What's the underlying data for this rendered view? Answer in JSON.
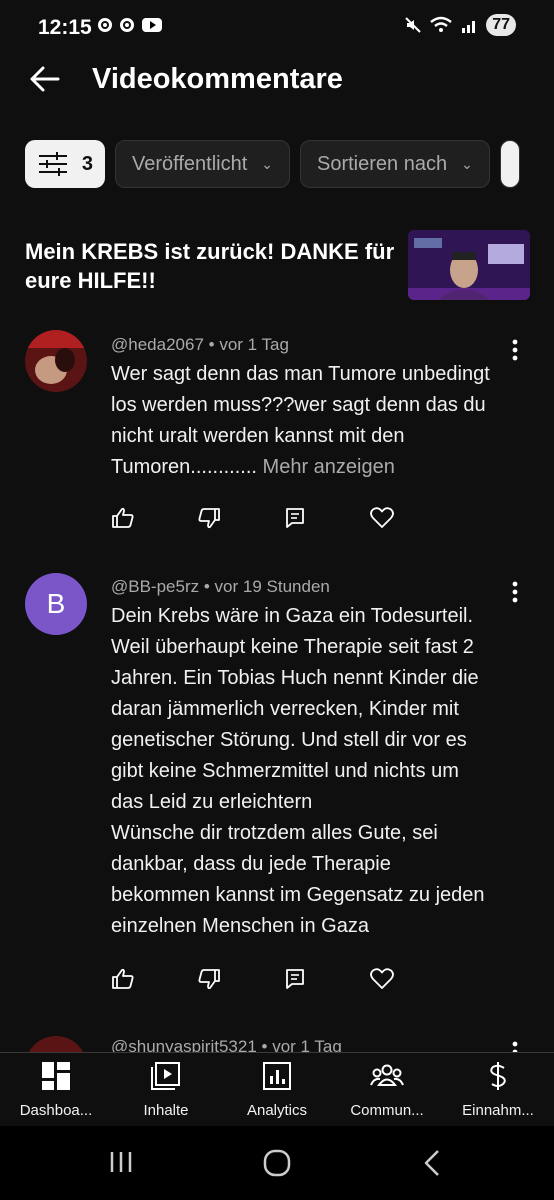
{
  "status_bar": {
    "time": "12:15",
    "battery": "77"
  },
  "app_bar": {
    "title": "Videokommentare"
  },
  "filters": {
    "filter_count": "3",
    "chips": [
      "Veröffentlicht",
      "Sortieren nach"
    ]
  },
  "video": {
    "title": "Mein KREBS ist zurück! DANKE für eure HILFE!!"
  },
  "comments": [
    {
      "author": "@heda2067",
      "age": "vor 1 Tag",
      "text": "Wer sagt denn das man Tumore unbedingt los werden muss???wer sagt denn das du nicht uralt werden kannst mit den Tumoren............",
      "more": "Mehr anzeigen"
    },
    {
      "author": "@BB-pe5rz",
      "age": "vor 19 Stunden",
      "avatar_letter": "B",
      "text_lines": [
        "Dein Krebs wäre in Gaza ein Todesurteil.",
        "Weil überhaupt keine Therapie seit fast 2",
        "Jahren. Ein Tobias Huch nennt Kinder die",
        "daran jämmerlich verrecken, Kinder mit",
        "genetischer Störung. Und stell dir vor es",
        "gibt keine Schmerzmittel und nichts um",
        "das Leid zu erleichtern",
        "Wünsche dir trotzdem alles Gute, sei",
        "dankbar, dass du jede Therapie",
        "bekommen kannst im Gegensatz zu jeden",
        "einzelnen Menschen in Gaza"
      ]
    },
    {
      "author": "@shunyaspirit5321",
      "age": "vor 1 Tag"
    }
  ],
  "bottom_nav": [
    {
      "label": "Dashboa...",
      "icon": "dashboard-icon"
    },
    {
      "label": "Inhalte",
      "icon": "content-icon"
    },
    {
      "label": "Analytics",
      "icon": "analytics-icon"
    },
    {
      "label": "Commun...",
      "icon": "community-icon"
    },
    {
      "label": "Einnahm...",
      "icon": "earnings-icon"
    }
  ],
  "colors": {
    "background": "#0f0f0f",
    "avatar_purple": "#7b56c9",
    "text": "#f1f1f1",
    "meta": "#aaaaaa"
  }
}
